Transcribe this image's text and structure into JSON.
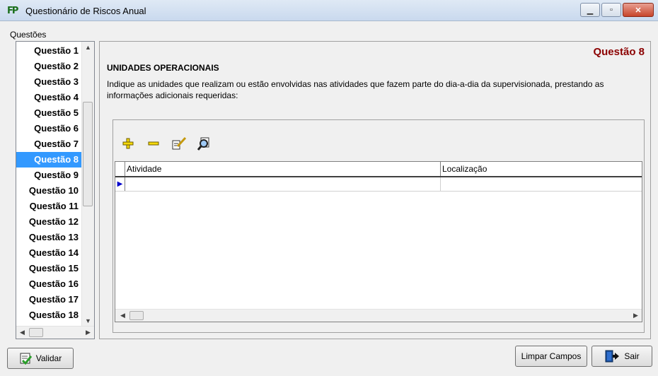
{
  "window": {
    "title": "Questionário de Riscos Anual",
    "app_icon_text": "FP"
  },
  "sidebar": {
    "label": "Questões",
    "items": [
      {
        "label": "Questão 1"
      },
      {
        "label": "Questão 2"
      },
      {
        "label": "Questão 3"
      },
      {
        "label": "Questão 4"
      },
      {
        "label": "Questão 5"
      },
      {
        "label": "Questão 6"
      },
      {
        "label": "Questão 7"
      },
      {
        "label": "Questão 8",
        "selected": true
      },
      {
        "label": "Questão 9"
      },
      {
        "label": "Questão 10"
      },
      {
        "label": "Questão 11"
      },
      {
        "label": "Questão 12"
      },
      {
        "label": "Questão 13"
      },
      {
        "label": "Questão 14"
      },
      {
        "label": "Questão 15"
      },
      {
        "label": "Questão 16"
      },
      {
        "label": "Questão 17"
      },
      {
        "label": "Questão 18"
      }
    ]
  },
  "main": {
    "question_number": "Questão 8",
    "heading": "UNIDADES OPERACIONAIS",
    "description": "Indique as unidades que realizam ou estão envolvidas nas atividades que fazem parte do dia-a-dia da supervisionada, prestando as informações adicionais requeridas:",
    "toolbar": [
      "add-icon",
      "remove-icon",
      "edit-icon",
      "search-icon"
    ],
    "grid": {
      "columns": [
        "Atividade",
        "Localização"
      ],
      "rows": [
        [
          "",
          ""
        ]
      ]
    }
  },
  "footer": {
    "validate_label": "Validar",
    "clear_label": "Limpar Campos",
    "exit_label": "Sair"
  },
  "colors": {
    "selection": "#3399ff",
    "question_number": "#8b0000"
  }
}
